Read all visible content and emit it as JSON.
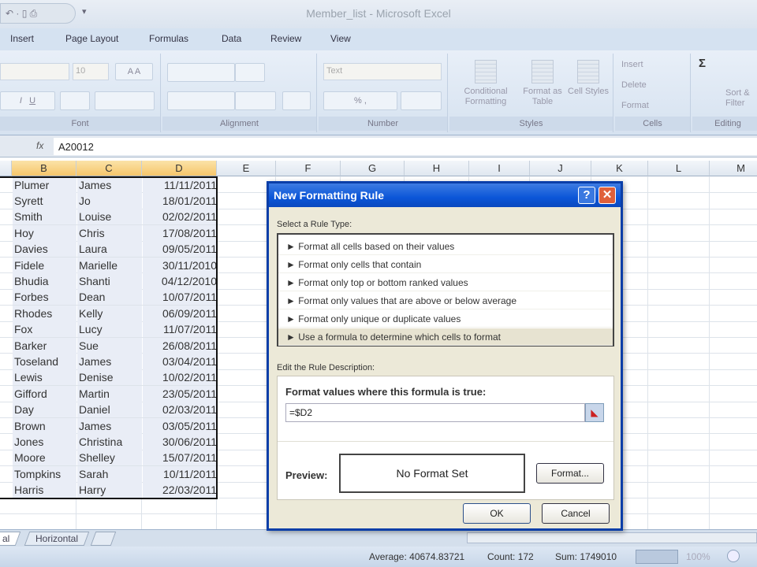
{
  "window": {
    "title": "Member_list - Microsoft Excel",
    "qat": "↶ · ▯ ⎙",
    "qat_more": "▾"
  },
  "ribbon_tabs": [
    "Insert",
    "Page Layout",
    "Formulas",
    "Data",
    "Review",
    "View"
  ],
  "ribbon": {
    "font": {
      "label": "Font",
      "size": "10",
      "grow": "A",
      "shrink": "A",
      "italic": "I",
      "underline": "U"
    },
    "alignment": {
      "label": "Alignment"
    },
    "number": {
      "label": "Number",
      "format": "Text",
      "percent": "%",
      "comma": ","
    },
    "styles": {
      "label": "Styles",
      "conditional": "Conditional Formatting",
      "format_table": "Format as Table",
      "cell_styles": "Cell Styles"
    },
    "cells": {
      "label": "Cells",
      "insert": "Insert",
      "delete": "Delete",
      "format": "Format"
    },
    "editing": {
      "label": "Editing",
      "sum": "Σ",
      "sort": "Sort & Filter"
    }
  },
  "formula_bar": {
    "fx": "fx",
    "value": "A20012"
  },
  "columns": [
    "B",
    "C",
    "D",
    "E",
    "F",
    "G",
    "H",
    "I",
    "J",
    "K",
    "L",
    "M"
  ],
  "rows": [
    [
      "Plumer",
      "James",
      "11/11/2011"
    ],
    [
      "Syrett",
      "Jo",
      "18/01/2011"
    ],
    [
      "Smith",
      "Louise",
      "02/02/2011"
    ],
    [
      "Hoy",
      "Chris",
      "17/08/2011"
    ],
    [
      "Davies",
      "Laura",
      "09/05/2011"
    ],
    [
      "Fidele",
      "Marielle",
      "30/11/2010"
    ],
    [
      "Bhudia",
      "Shanti",
      "04/12/2010"
    ],
    [
      "Forbes",
      "Dean",
      "10/07/2011"
    ],
    [
      "Rhodes",
      "Kelly",
      "06/09/2011"
    ],
    [
      "Fox",
      "Lucy",
      "11/07/2011"
    ],
    [
      "Barker",
      "Sue",
      "26/08/2011"
    ],
    [
      "Toseland",
      "James",
      "03/04/2011"
    ],
    [
      "Lewis",
      "Denise",
      "10/02/2011"
    ],
    [
      "Gifford",
      "Martin",
      "23/05/2011"
    ],
    [
      "Day",
      "Daniel",
      "02/03/2011"
    ],
    [
      "Brown",
      "James",
      "03/05/2011"
    ],
    [
      "Jones",
      "Christina",
      "30/06/2011"
    ],
    [
      "Moore",
      "Shelley",
      "15/07/2011"
    ],
    [
      "Tompkins",
      "Sarah",
      "10/11/2011"
    ],
    [
      "Harris",
      "Harry",
      "22/03/2011"
    ]
  ],
  "sheet_tabs": [
    "al",
    "Horizontal"
  ],
  "status": {
    "average": "Average: 40674.83721",
    "count": "Count: 172",
    "sum": "Sum: 1749010",
    "zoom": "100%"
  },
  "dialog": {
    "title": "New Formatting Rule",
    "help": "?",
    "close": "✕",
    "select_label": "Select a Rule Type:",
    "rule_types": [
      "► Format all cells based on their values",
      "► Format only cells that contain",
      "► Format only top or bottom ranked values",
      "► Format only values that are above or below average",
      "► Format only unique or duplicate values",
      "► Use a formula to determine which cells to format"
    ],
    "selected_rule": 5,
    "edit_label": "Edit the Rule Description:",
    "formula_label": "Format values where this formula is true:",
    "formula_value": "=$D2",
    "preview_label": "Preview:",
    "preview_text": "No Format Set",
    "format_button": "Format...",
    "ok": "OK",
    "cancel": "Cancel"
  }
}
